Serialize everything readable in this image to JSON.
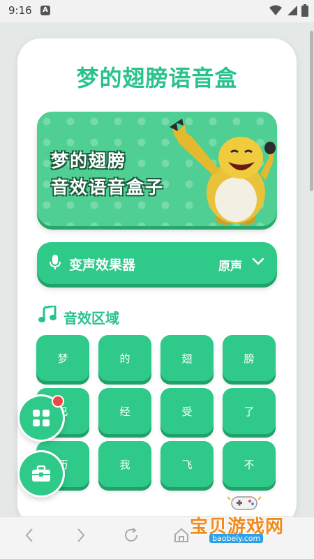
{
  "status": {
    "time": "9:16",
    "notif": "A"
  },
  "app": {
    "title": "梦的翅膀语音盒"
  },
  "banner": {
    "line1": "梦的翅膀",
    "line2": "音效语音盒子"
  },
  "voice_changer": {
    "label": "变声效果器",
    "value": "原声"
  },
  "section": {
    "title": "音效区域"
  },
  "sound_buttons": [
    "梦",
    "的",
    "翅",
    "膀",
    "已",
    "经",
    "受",
    "了",
    "历",
    "我",
    "飞",
    "不"
  ],
  "colors": {
    "accent": "#28c38b",
    "button": "#2fc98a",
    "badge": "#f04848"
  },
  "watermark": {
    "brand": "宝贝游戏网",
    "url": "baobeiy.com"
  }
}
